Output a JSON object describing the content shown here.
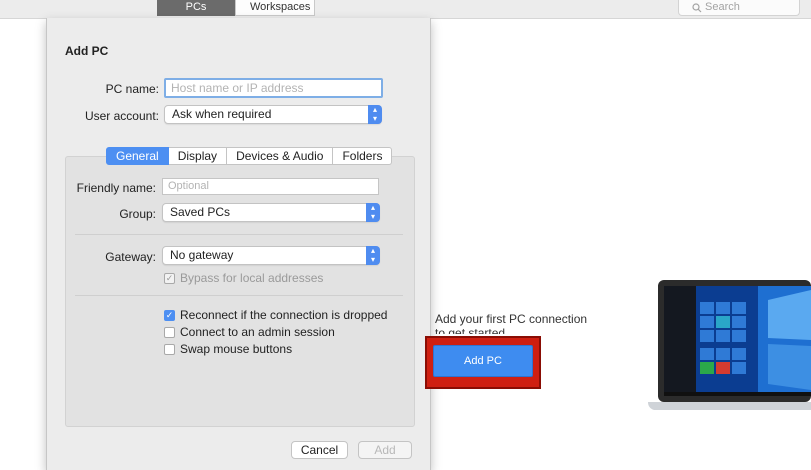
{
  "toolbar": {
    "tabs": [
      {
        "label": "PCs",
        "selected": true
      },
      {
        "label": "Workspaces",
        "selected": false
      }
    ],
    "search": {
      "placeholder": "Search",
      "icon": "search-icon"
    }
  },
  "sheet": {
    "title": "Add PC",
    "pc_name": {
      "label": "PC name:",
      "placeholder": "Host name or IP address",
      "value": ""
    },
    "user_account": {
      "label": "User account:",
      "value": "Ask when required"
    },
    "tabs": [
      {
        "label": "General",
        "selected": true
      },
      {
        "label": "Display",
        "selected": false
      },
      {
        "label": "Devices & Audio",
        "selected": false
      },
      {
        "label": "Folders",
        "selected": false
      }
    ],
    "general": {
      "friendly_name": {
        "label": "Friendly name:",
        "placeholder": "Optional",
        "value": ""
      },
      "group": {
        "label": "Group:",
        "value": "Saved PCs"
      },
      "gateway": {
        "label": "Gateway:",
        "value": "No gateway"
      },
      "bypass": {
        "label": "Bypass for local addresses",
        "checked": true,
        "enabled": false
      },
      "reconnect": {
        "label": "Reconnect if the connection is dropped",
        "checked": true
      },
      "admin_session": {
        "label": "Connect to an admin session",
        "checked": false
      },
      "swap_mouse": {
        "label": "Swap mouse buttons",
        "checked": false
      }
    },
    "buttons": {
      "cancel": "Cancel",
      "add": "Add"
    }
  },
  "main": {
    "empty_message": "Add your first PC connection to get started",
    "add_pc_button": "Add PC",
    "highlight_color": "#cf1f11",
    "accent_color": "#3e8cf0"
  }
}
